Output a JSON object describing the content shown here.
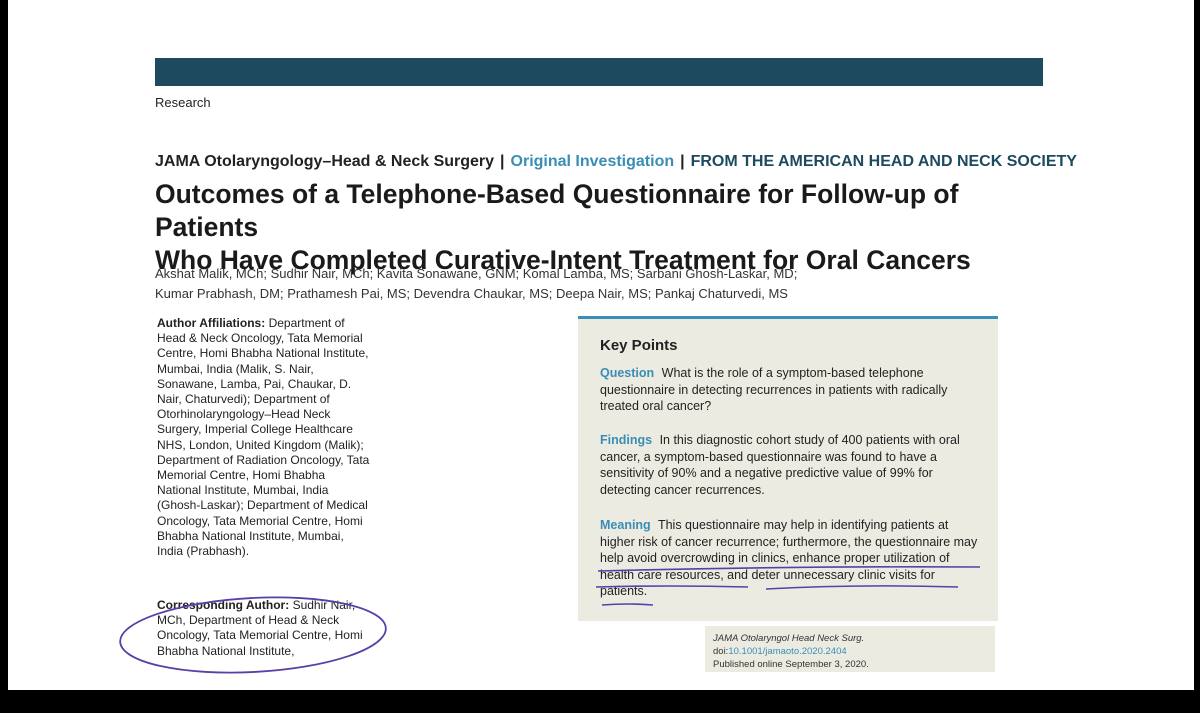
{
  "section_label": "Research",
  "journal_line": {
    "journal": "JAMA Otolaryngology–Head & Neck Surgery",
    "separator": "|",
    "article_type": "Original Investigation",
    "society": "FROM THE AMERICAN HEAD AND NECK SOCIETY"
  },
  "title_lines": [
    "Outcomes of a Telephone-Based Questionnaire for Follow-up of Patients",
    "Who Have Completed Curative-Intent Treatment for Oral Cancers"
  ],
  "authors_lines": [
    "Akshat Malik, MCh; Sudhir Nair, MCh; Kavita Sonawane, GNM; Komal Lamba, MS; Sarbani Ghosh-Laskar, MD;",
    "Kumar Prabhash, DM; Prathamesh Pai, MS; Devendra Chaukar, MS; Deepa Nair, MS; Pankaj Chaturvedi, MS"
  ],
  "affiliations": {
    "label": "Author Affiliations:",
    "text": "Department of Head & Neck Oncology, Tata Memorial Centre, Homi Bhabha National Institute, Mumbai, India (Malik, S. Nair, Sonawane, Lamba, Pai, Chaukar, D. Nair, Chaturvedi); Department of Otorhinolaryngology–Head Neck Surgery, Imperial College Healthcare NHS, London, United Kingdom (Malik); Department of Radiation Oncology, Tata Memorial Centre, Homi Bhabha National Institute, Mumbai, India (Ghosh-Laskar); Department of Medical Oncology, Tata Memorial Centre, Homi Bhabha National Institute, Mumbai, India (Prabhash)."
  },
  "corresponding_author": {
    "label": "Corresponding Author:",
    "text": "Sudhir Nair, MCh, Department of Head & Neck Oncology, Tata Memorial Centre, Homi Bhabha National Institute,"
  },
  "key_points": {
    "heading": "Key Points",
    "question": {
      "label": "Question",
      "text": "What is the role of a symptom-based telephone questionnaire in detecting recurrences in patients with radically treated oral cancer?"
    },
    "findings": {
      "label": "Findings",
      "text": "In this diagnostic cohort study of 400 patients with oral cancer, a symptom-based questionnaire was found to have a sensitivity of 90% and a negative predictive value of 99% for detecting cancer recurrences."
    },
    "meaning": {
      "label": "Meaning",
      "text": "This questionnaire may help in identifying patients at higher risk of cancer recurrence; furthermore, the questionnaire may help avoid overcrowding in clinics, enhance proper utilization of health care resources, and deter unnecessary clinic visits for patients."
    }
  },
  "citation": {
    "journal_abbrev": "JAMA Otolaryngol Head Neck Surg.",
    "doi_prefix": "doi:",
    "doi": "10.1001/jamaoto.2020.2404",
    "published": "Published online September 3, 2020."
  },
  "colors": {
    "header_bar": "#1e4a5f",
    "accent_blue": "#3a8db5",
    "key_points_bg": "#ecebe2",
    "annotation_ink": "#5b3fa8"
  }
}
